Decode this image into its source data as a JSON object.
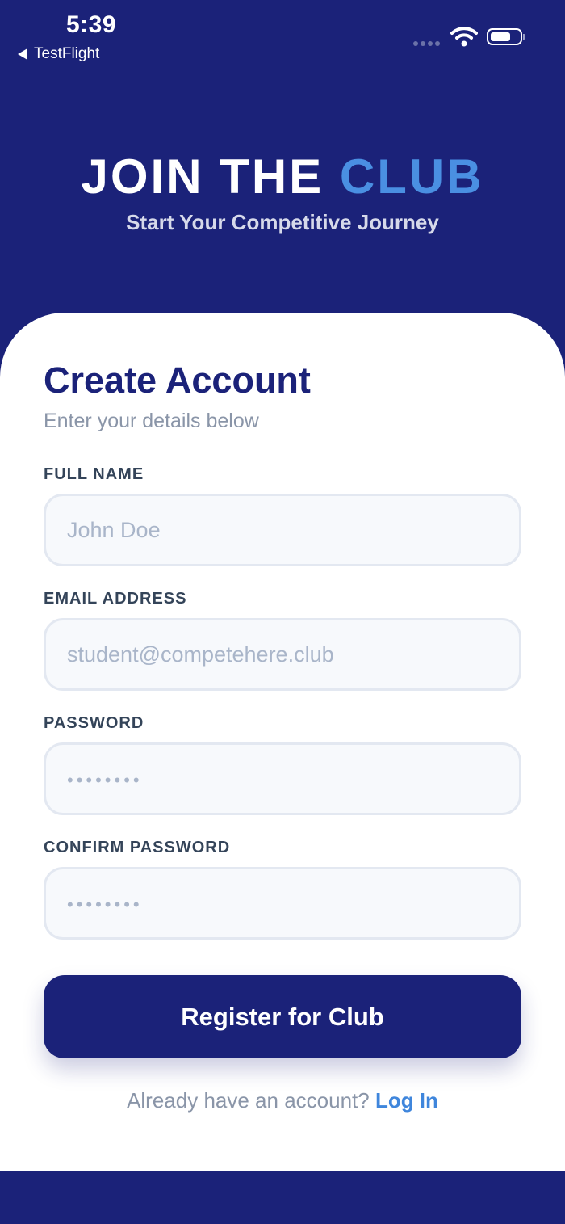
{
  "status_bar": {
    "time": "5:39",
    "back_app": "TestFlight"
  },
  "hero": {
    "title_main": "JOIN THE ",
    "title_accent": "CLUB",
    "subtitle": "Start Your Competitive Journey"
  },
  "form": {
    "title": "Create Account",
    "subtitle": "Enter your details below",
    "full_name": {
      "label": "FULL NAME",
      "placeholder": "John Doe"
    },
    "email": {
      "label": "EMAIL ADDRESS",
      "placeholder": "student@competehere.club"
    },
    "password": {
      "label": "PASSWORD",
      "placeholder": "••••••••"
    },
    "confirm_password": {
      "label": "CONFIRM PASSWORD",
      "placeholder": "••••••••"
    },
    "register_label": "Register for Club",
    "login_prompt": "Already have an account? ",
    "login_link": "Log In"
  },
  "colors": {
    "primary": "#1b2279",
    "accent": "#4a8fe2",
    "link": "#3f86dc"
  }
}
